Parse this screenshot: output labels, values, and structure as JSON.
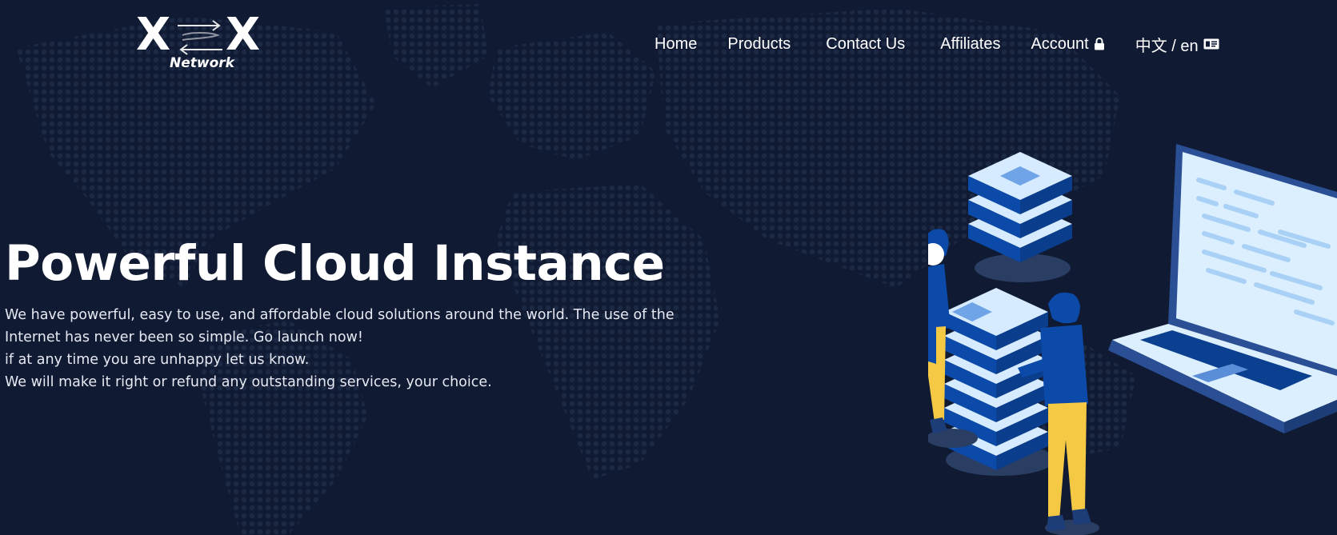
{
  "brand": {
    "logo_letter_left": "X",
    "logo_letter_right": "X",
    "logo_subtitle": "Network"
  },
  "nav": {
    "items": [
      {
        "label": "Home"
      },
      {
        "label": "Products"
      },
      {
        "label": "Contact Us"
      },
      {
        "label": "Affiliates"
      },
      {
        "label": "Account",
        "icon": "lock-icon"
      },
      {
        "label": "中文 / en",
        "icon": "language-card-icon"
      }
    ]
  },
  "hero": {
    "title": "Powerful Cloud Instance",
    "description_lines": [
      "We have powerful, easy to use, and affordable cloud solutions around the world. The use of the Internet has never been so simple. Go launch now!",
      "if at any time you are unhappy let us know.",
      "We will make it right or refund any outstanding services, your choice."
    ]
  },
  "colors": {
    "background": "#101b33",
    "map_dots": "#1d2a45",
    "server_blue": "#0b4aa8",
    "server_light": "#d6ebff",
    "person_yellow": "#f6c945",
    "text": "#ffffff"
  }
}
